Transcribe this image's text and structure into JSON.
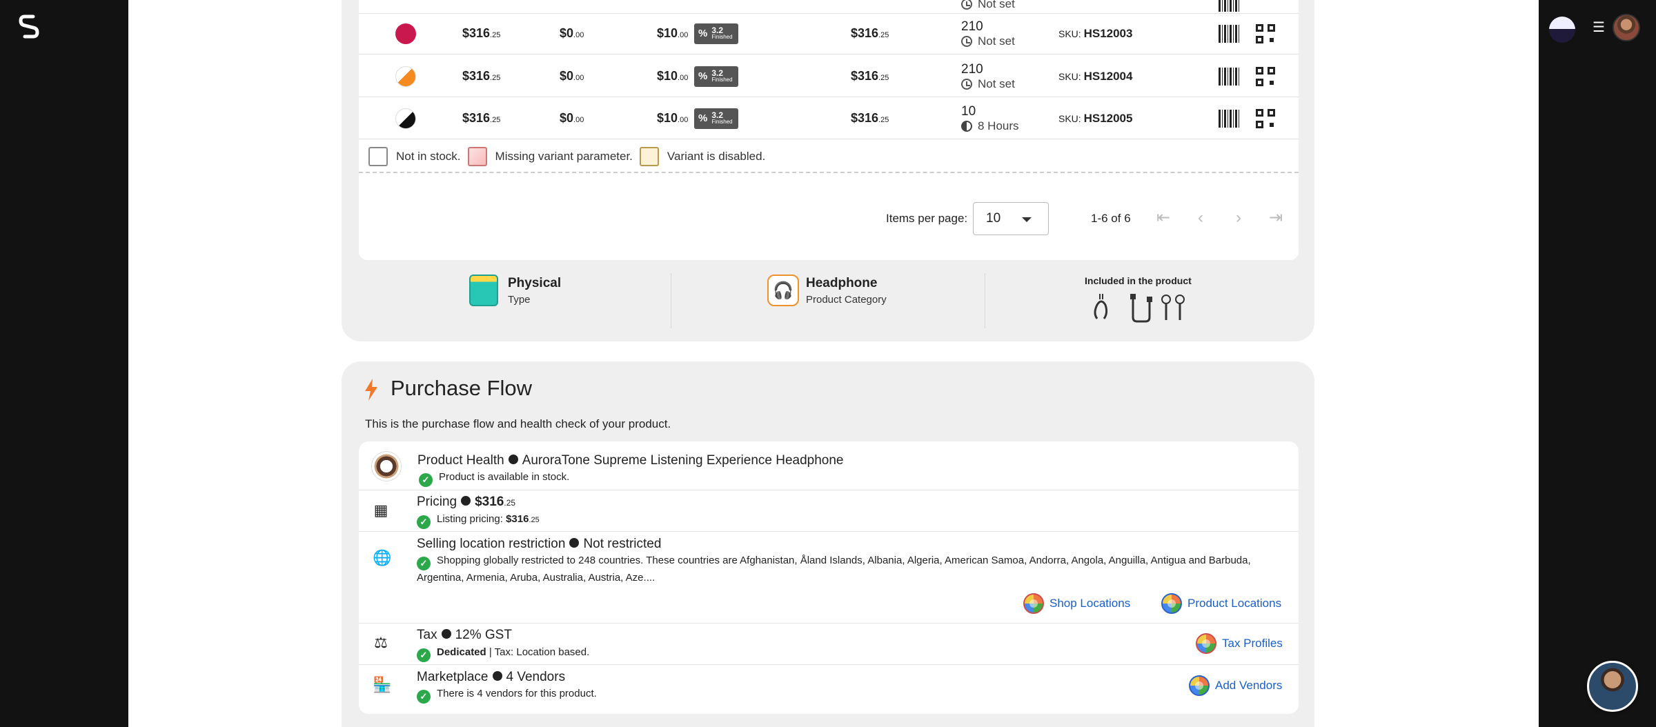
{
  "table": {
    "rows": [
      {
        "color": "#c8184e",
        "price": "$316",
        "price_dec": ".25",
        "discount": "$0",
        "discount_dec": ".00",
        "fee": "$10",
        "fee_dec": ".00",
        "badge_value": "3.2",
        "badge_label": "Finished",
        "final": "$316",
        "final_dec": ".25",
        "qty": "210",
        "lead": "Not set",
        "sku_label": "SKU:",
        "sku": "HS12003"
      },
      {
        "color": "#f58a1f",
        "price": "$316",
        "price_dec": ".25",
        "discount": "$0",
        "discount_dec": ".00",
        "fee": "$10",
        "fee_dec": ".00",
        "badge_value": "3.2",
        "badge_label": "Finished",
        "final": "$316",
        "final_dec": ".25",
        "qty": "210",
        "lead": "Not set",
        "sku_label": "SKU:",
        "sku": "HS12004"
      },
      {
        "color": "#111111",
        "price": "$316",
        "price_dec": ".25",
        "discount": "$0",
        "discount_dec": ".00",
        "fee": "$10",
        "fee_dec": ".00",
        "badge_value": "3.2",
        "badge_label": "Finished",
        "final": "$316",
        "final_dec": ".25",
        "qty": "10",
        "lead": "8 Hours",
        "sku_label": "SKU:",
        "sku": "HS12005"
      }
    ],
    "partial_top_lead": "Not set",
    "legend": {
      "not_in_stock": "Not in stock.",
      "missing_param": "Missing variant parameter.",
      "disabled": "Variant is disabled."
    },
    "legend_colors": {
      "not_in_stock": "#ffffff",
      "missing_param": "#fbd6d6",
      "disabled": "#fdf2d6"
    },
    "pagination": {
      "items_per_page_label": "Items per page:",
      "items_per_page_value": "10",
      "range": "1-6 of 6"
    }
  },
  "meta": {
    "type_title": "Physical",
    "type_sub": "Type",
    "category_title": "Headphone",
    "category_sub": "Product Category",
    "included_title": "Included in the product"
  },
  "purchase_flow": {
    "title": "Purchase Flow",
    "description": "This is the purchase flow and health check of your product.",
    "health": {
      "label": "Product Health",
      "product_name": "AuroraTone Supreme Listening Experience Headphone",
      "status": "Product is available in stock."
    },
    "pricing": {
      "label": "Pricing",
      "value": "$316",
      "value_dec": ".25",
      "listing_label": "Listing pricing:",
      "listing_value": "$316",
      "listing_dec": ".25"
    },
    "location": {
      "label": "Selling location restriction",
      "value": "Not restricted",
      "detail": "Shopping globally restricted to 248 countries. These countries are Afghanistan, Åland Islands, Albania, Algeria, American Samoa, Andorra, Angola, Anguilla, Antigua and Barbuda, Argentina, Armenia, Aruba, Australia, Austria, Aze....",
      "shop_link": "Shop Locations",
      "product_link": "Product Locations"
    },
    "tax": {
      "label": "Tax",
      "value": "12% GST",
      "dedicated": "Dedicated",
      "detail": "| Tax: Location based.",
      "link": "Tax Profiles"
    },
    "marketplace": {
      "label": "Marketplace",
      "value": "4 Vendors",
      "detail": "There is 4 vendors for this product.",
      "link": "Add Vendors"
    }
  },
  "icons": {
    "logo": "selldone-logo-icon",
    "menu": "hamburger-menu-icon",
    "bolt": "lightning-bolt-icon",
    "calculator": "calculator-icon",
    "globe": "globe-icon",
    "scale": "balance-scale-icon",
    "store": "storefront-icon"
  },
  "colors": {
    "accent_link": "#1a5fc9",
    "check_green": "#2aa84a",
    "badge_bg": "#555555",
    "bolt": "#f07a2a"
  }
}
